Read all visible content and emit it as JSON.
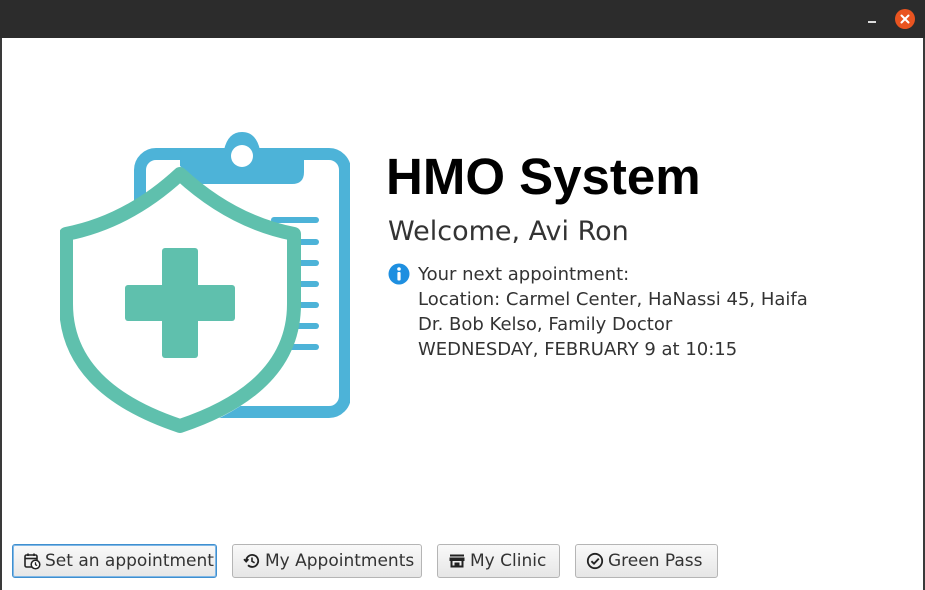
{
  "window": {
    "title": "",
    "minimize_label": "_",
    "close_label": "×"
  },
  "brand": {
    "logo_icon": "shield-cross-clipboard-icon",
    "shield_color": "#5fc0ad",
    "clipboard_color": "#4db3d8"
  },
  "header": {
    "title": "HMO System",
    "welcome": "Welcome, Avi Ron"
  },
  "appointment": {
    "icon": "info-icon",
    "heading": "Your next appointment:",
    "location": "Location: Carmel Center, HaNassi 45, Haifa",
    "doctor": "Dr. Bob Kelso, Family Doctor",
    "datetime": "WEDNESDAY, FEBRUARY 9 at 10:15"
  },
  "toolbar": {
    "set_appointment": {
      "label": "Set an appointment",
      "icon": "calendar-clock-icon"
    },
    "my_appointments": {
      "label": "My Appointments",
      "icon": "history-icon"
    },
    "my_clinic": {
      "label": "My Clinic",
      "icon": "store-icon"
    },
    "green_pass": {
      "label": "Green Pass",
      "icon": "check-circle-icon"
    }
  }
}
